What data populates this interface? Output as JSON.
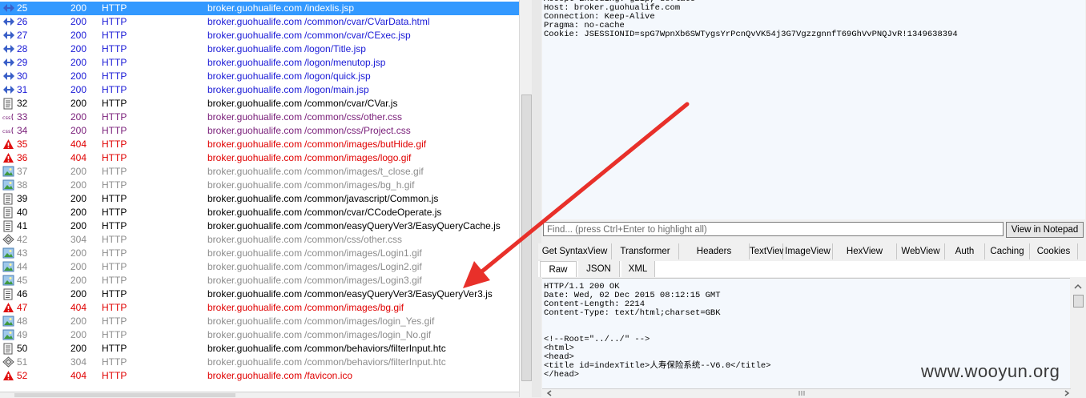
{
  "sessions": [
    {
      "num": "25",
      "result": "200",
      "protocol": "HTTP",
      "host": "broker.guohualife.com",
      "url": "/indexlis.jsp",
      "icon": "arrows-icon",
      "color": "blue",
      "selected": true
    },
    {
      "num": "26",
      "result": "200",
      "protocol": "HTTP",
      "host": "broker.guohualife.com",
      "url": "/common/cvar/CVarData.html",
      "icon": "arrows-icon",
      "color": "blue"
    },
    {
      "num": "27",
      "result": "200",
      "protocol": "HTTP",
      "host": "broker.guohualife.com",
      "url": "/common/cvar/CExec.jsp",
      "icon": "arrows-icon",
      "color": "blue"
    },
    {
      "num": "28",
      "result": "200",
      "protocol": "HTTP",
      "host": "broker.guohualife.com",
      "url": "/logon/Title.jsp",
      "icon": "arrows-icon",
      "color": "blue"
    },
    {
      "num": "29",
      "result": "200",
      "protocol": "HTTP",
      "host": "broker.guohualife.com",
      "url": "/logon/menutop.jsp",
      "icon": "arrows-icon",
      "color": "blue"
    },
    {
      "num": "30",
      "result": "200",
      "protocol": "HTTP",
      "host": "broker.guohualife.com",
      "url": "/logon/quick.jsp",
      "icon": "arrows-icon",
      "color": "blue"
    },
    {
      "num": "31",
      "result": "200",
      "protocol": "HTTP",
      "host": "broker.guohualife.com",
      "url": "/logon/main.jsp",
      "icon": "arrows-icon",
      "color": "blue"
    },
    {
      "num": "32",
      "result": "200",
      "protocol": "HTTP",
      "host": "broker.guohualife.com",
      "url": "/common/cvar/CVar.js",
      "icon": "script-icon",
      "color": "black"
    },
    {
      "num": "33",
      "result": "200",
      "protocol": "HTTP",
      "host": "broker.guohualife.com",
      "url": "/common/css/other.css",
      "icon": "css-icon",
      "color": "purple"
    },
    {
      "num": "34",
      "result": "200",
      "protocol": "HTTP",
      "host": "broker.guohualife.com",
      "url": "/common/css/Project.css",
      "icon": "css-icon",
      "color": "purple"
    },
    {
      "num": "35",
      "result": "404",
      "protocol": "HTTP",
      "host": "broker.guohualife.com",
      "url": "/common/images/butHide.gif",
      "icon": "warning-icon",
      "color": "red"
    },
    {
      "num": "36",
      "result": "404",
      "protocol": "HTTP",
      "host": "broker.guohualife.com",
      "url": "/common/images/logo.gif",
      "icon": "warning-icon",
      "color": "red"
    },
    {
      "num": "37",
      "result": "200",
      "protocol": "HTTP",
      "host": "broker.guohualife.com",
      "url": "/common/images/t_close.gif",
      "icon": "image-icon",
      "color": "gray"
    },
    {
      "num": "38",
      "result": "200",
      "protocol": "HTTP",
      "host": "broker.guohualife.com",
      "url": "/common/images/bg_h.gif",
      "icon": "image-icon",
      "color": "gray"
    },
    {
      "num": "39",
      "result": "200",
      "protocol": "HTTP",
      "host": "broker.guohualife.com",
      "url": "/common/javascript/Common.js",
      "icon": "script-icon",
      "color": "black"
    },
    {
      "num": "40",
      "result": "200",
      "protocol": "HTTP",
      "host": "broker.guohualife.com",
      "url": "/common/cvar/CCodeOperate.js",
      "icon": "script-icon",
      "color": "black"
    },
    {
      "num": "41",
      "result": "200",
      "protocol": "HTTP",
      "host": "broker.guohualife.com",
      "url": "/common/easyQueryVer3/EasyQueryCache.js",
      "icon": "script-icon",
      "color": "black"
    },
    {
      "num": "42",
      "result": "304",
      "protocol": "HTTP",
      "host": "broker.guohualife.com",
      "url": "/common/css/other.css",
      "icon": "cached-icon",
      "color": "gray"
    },
    {
      "num": "43",
      "result": "200",
      "protocol": "HTTP",
      "host": "broker.guohualife.com",
      "url": "/common/images/Login1.gif",
      "icon": "image-icon",
      "color": "gray"
    },
    {
      "num": "44",
      "result": "200",
      "protocol": "HTTP",
      "host": "broker.guohualife.com",
      "url": "/common/images/Login2.gif",
      "icon": "image-icon",
      "color": "gray"
    },
    {
      "num": "45",
      "result": "200",
      "protocol": "HTTP",
      "host": "broker.guohualife.com",
      "url": "/common/images/Login3.gif",
      "icon": "image-icon",
      "color": "gray"
    },
    {
      "num": "46",
      "result": "200",
      "protocol": "HTTP",
      "host": "broker.guohualife.com",
      "url": "/common/easyQueryVer3/EasyQueryVer3.js",
      "icon": "script-icon",
      "color": "black"
    },
    {
      "num": "47",
      "result": "404",
      "protocol": "HTTP",
      "host": "broker.guohualife.com",
      "url": "/common/images/bg.gif",
      "icon": "warning-icon",
      "color": "red"
    },
    {
      "num": "48",
      "result": "200",
      "protocol": "HTTP",
      "host": "broker.guohualife.com",
      "url": "/common/images/login_Yes.gif",
      "icon": "image-icon",
      "color": "gray"
    },
    {
      "num": "49",
      "result": "200",
      "protocol": "HTTP",
      "host": "broker.guohualife.com",
      "url": "/common/images/login_No.gif",
      "icon": "image-icon",
      "color": "gray"
    },
    {
      "num": "50",
      "result": "200",
      "protocol": "HTTP",
      "host": "broker.guohualife.com",
      "url": "/common/behaviors/filterInput.htc",
      "icon": "script-icon",
      "color": "black"
    },
    {
      "num": "51",
      "result": "304",
      "protocol": "HTTP",
      "host": "broker.guohualife.com",
      "url": "/common/behaviors/filterInput.htc",
      "icon": "cached-icon",
      "color": "gray"
    },
    {
      "num": "52",
      "result": "404",
      "protocol": "HTTP",
      "host": "broker.guohualife.com",
      "url": "/favicon.ico",
      "icon": "warning-icon",
      "color": "red"
    }
  ],
  "request_headers": "Accept-Encoding: gzip, deflate\nHost: broker.guohualife.com\nConnection: Keep-Alive\nPragma: no-cache\nCookie: JSESSIONID=spG7WpnXb6SWTygsYrPcnQvVK54j3G7VgzzgnnfT69GhVvPNQJvR!1349638394",
  "find_placeholder": "Find... (press Ctrl+Enter to highlight all)",
  "view_in_notepad": "View in Notepad",
  "inspector_tabs": [
    "Get SyntaxView",
    "Transformer",
    "Headers",
    "TextView",
    "ImageView",
    "HexView",
    "WebView",
    "Auth",
    "Caching",
    "Cookies"
  ],
  "format_tabs": [
    "Raw",
    "JSON",
    "XML"
  ],
  "response_text": "HTTP/1.1 200 OK\nDate: Wed, 02 Dec 2015 08:12:15 GMT\nContent-Length: 2214\nContent-Type: text/html;charset=GBK\n\n\n<!--Root=\"../../\" -->\n<html>\n<head>\n<title id=indexTitle>人寿保险系统--V6.0</title>\n</head>",
  "watermark": "www.wooyun.org",
  "colors": {
    "blue": "#1919d6",
    "black": "#000000",
    "purple": "#7b217b",
    "red": "#e00000",
    "gray": "#8c8c8c",
    "selection": "#3399ff",
    "arrow": "#e8302a"
  }
}
